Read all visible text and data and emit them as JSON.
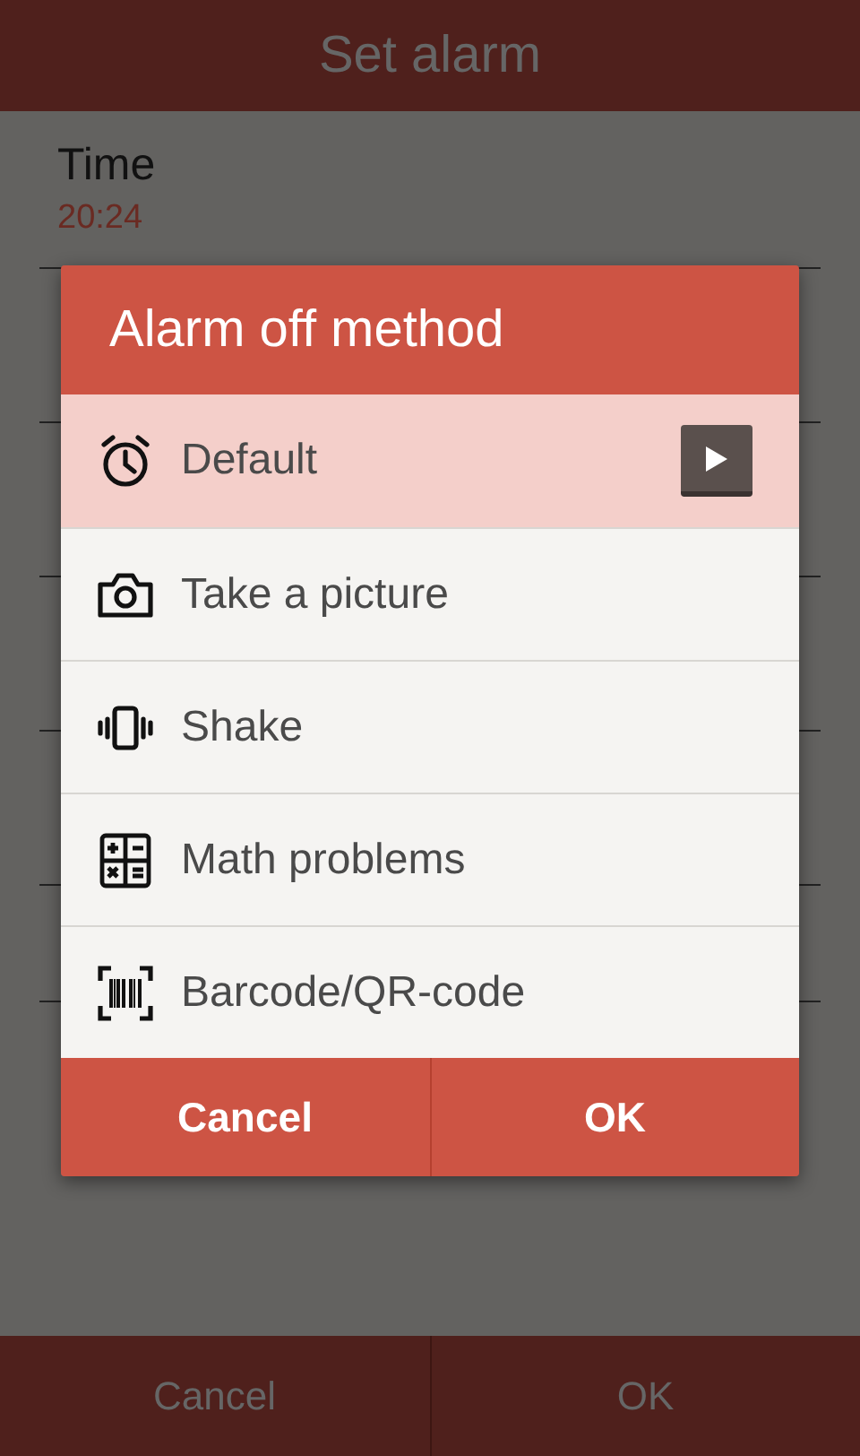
{
  "screen": {
    "title": "Set alarm"
  },
  "settings": [
    {
      "label": "Time",
      "value": "20:24"
    }
  ],
  "footer_buttons": [
    {
      "label": "Cancel"
    },
    {
      "label": "OK"
    }
  ],
  "dialog": {
    "title": "Alarm off method",
    "options": [
      {
        "kind": "alarm",
        "label": "Default",
        "selected": true
      },
      {
        "kind": "camera",
        "label": "Take a picture",
        "selected": false
      },
      {
        "kind": "vibrate",
        "label": "Shake",
        "selected": false
      },
      {
        "kind": "calculator",
        "label": "Math problems",
        "selected": false
      },
      {
        "kind": "barcode",
        "label": "Barcode/QR-code",
        "selected": false
      }
    ],
    "buttons": [
      {
        "label": "Cancel"
      },
      {
        "label": "OK"
      }
    ]
  }
}
